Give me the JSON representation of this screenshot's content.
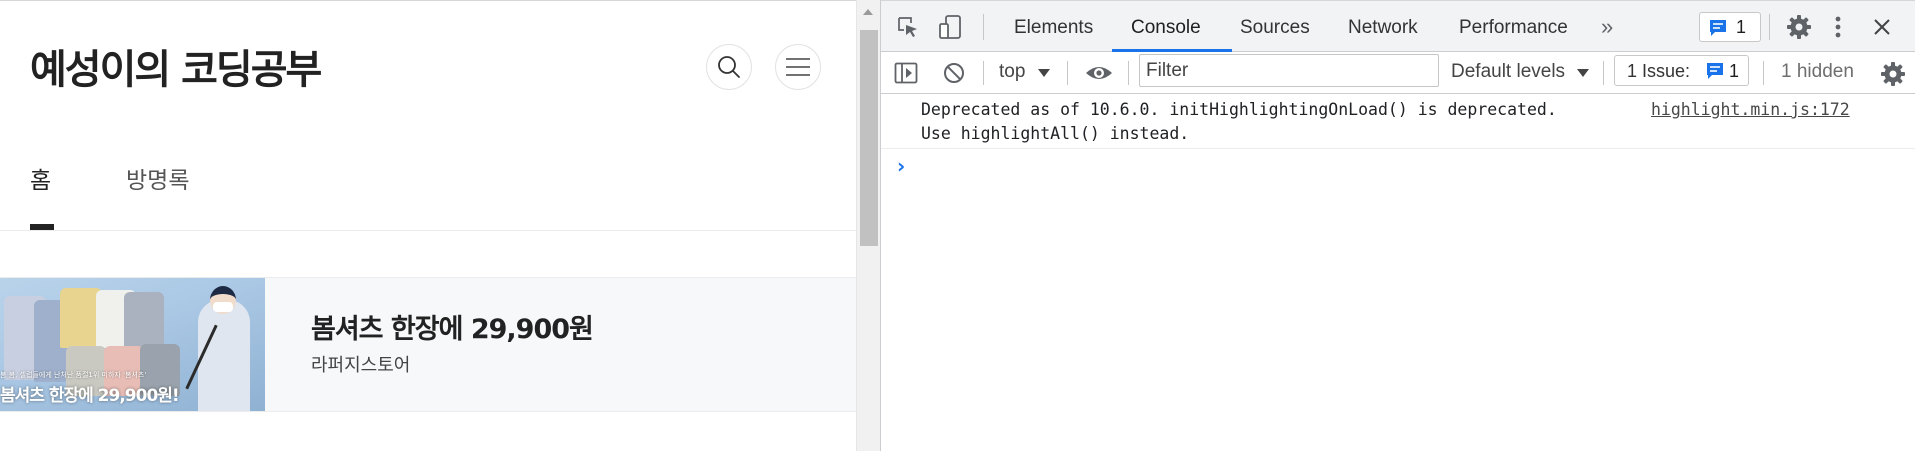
{
  "blog": {
    "title": "예성이의 코딩공부",
    "tabs": [
      {
        "label": "홈",
        "active": true
      },
      {
        "label": "방명록",
        "active": false
      }
    ],
    "icons": {
      "search": "search-icon",
      "menu": "hamburger-menu-icon"
    }
  },
  "ad": {
    "image_text": "봄셔츠 한장에 29,900원!",
    "image_subtext": "봄 봄, 셀럽들에게 난처난 품절1위 미하자 '봄셔츠'",
    "title": "봄셔츠 한장에 29,900원",
    "advertiser": "라퍼지스토어"
  },
  "devtools": {
    "tabs": [
      {
        "label": "Elements",
        "active": false
      },
      {
        "label": "Console",
        "active": true
      },
      {
        "label": "Sources",
        "active": false
      },
      {
        "label": "Network",
        "active": false
      },
      {
        "label": "Performance",
        "active": false
      }
    ],
    "more_tabs_glyph": "»",
    "message_badge_count": "1",
    "toolbar": {
      "context": "top",
      "filter_placeholder": "Filter",
      "levels": "Default levels",
      "issues_label": "1 Issue:",
      "issues_count": "1",
      "hidden": "1 hidden"
    },
    "console": {
      "message_line1": "Deprecated as of 10.6.0. initHighlightingOnLoad() is deprecated.",
      "message_line2": "Use highlightAll() instead.",
      "message_source": "highlight.min.js:172",
      "prompt": "›"
    },
    "accent_color": "#1a73e8"
  }
}
